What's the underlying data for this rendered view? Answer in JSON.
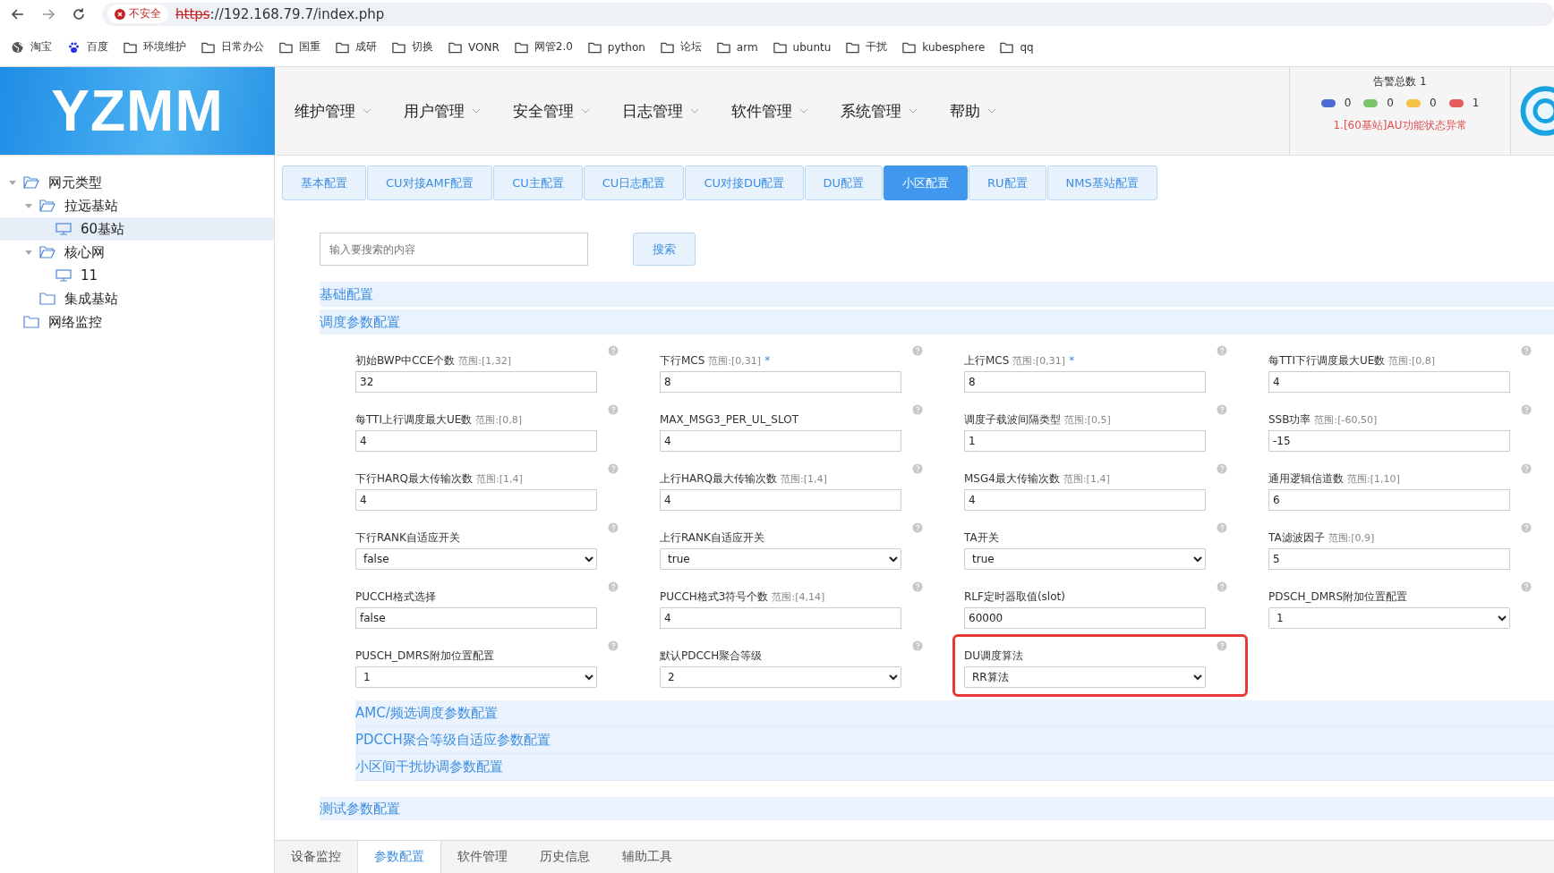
{
  "browser": {
    "security_label": "不安全",
    "url_scheme": "https",
    "url_rest": "://192.168.79.7/index.php"
  },
  "bookmarks": [
    {
      "label": "淘宝",
      "kind": "globe"
    },
    {
      "label": "百度",
      "kind": "paw"
    },
    {
      "label": "环境维护",
      "kind": "folder"
    },
    {
      "label": "日常办公",
      "kind": "folder"
    },
    {
      "label": "国重",
      "kind": "folder"
    },
    {
      "label": "成研",
      "kind": "folder"
    },
    {
      "label": "切换",
      "kind": "folder"
    },
    {
      "label": "VONR",
      "kind": "folder"
    },
    {
      "label": "网管2.0",
      "kind": "folder"
    },
    {
      "label": "python",
      "kind": "folder"
    },
    {
      "label": "论坛",
      "kind": "folder"
    },
    {
      "label": "arm",
      "kind": "folder"
    },
    {
      "label": "ubuntu",
      "kind": "folder"
    },
    {
      "label": "干扰",
      "kind": "folder"
    },
    {
      "label": "kubesphere",
      "kind": "folder"
    },
    {
      "label": "qq",
      "kind": "folder"
    }
  ],
  "header": {
    "logo": "YZMM",
    "menu": [
      "维护管理",
      "用户管理",
      "安全管理",
      "日志管理",
      "软件管理",
      "系统管理",
      "帮助"
    ],
    "alarm": {
      "title": "告警总数 1",
      "counters": [
        {
          "color": "#4a6bd0",
          "count": "0"
        },
        {
          "color": "#7cc46a",
          "count": "0"
        },
        {
          "color": "#f5c343",
          "count": "0"
        },
        {
          "color": "#e55a5a",
          "count": "1"
        }
      ],
      "message": "1.[60基站]AU功能状态异常"
    }
  },
  "tree": [
    {
      "label": "网元类型",
      "kind": "folder",
      "expanded": true,
      "selected": false,
      "children": [
        {
          "label": "拉远基站",
          "kind": "folder",
          "expanded": true,
          "selected": false,
          "children": [
            {
              "label": "60基站",
              "kind": "device",
              "selected": true
            }
          ]
        },
        {
          "label": "核心网",
          "kind": "folder",
          "expanded": true,
          "selected": false,
          "children": [
            {
              "label": "11",
              "kind": "device",
              "selected": false
            }
          ]
        },
        {
          "label": "集成基站",
          "kind": "folder",
          "selected": false
        }
      ]
    },
    {
      "label": "网络监控",
      "kind": "folder",
      "expanded": false,
      "selected": false
    }
  ],
  "config_tabs": [
    {
      "label": "基本配置",
      "selected": false
    },
    {
      "label": "CU对接AMF配置",
      "selected": false
    },
    {
      "label": "CU主配置",
      "selected": false
    },
    {
      "label": "CU日志配置",
      "selected": false
    },
    {
      "label": "CU对接DU配置",
      "selected": false
    },
    {
      "label": "DU配置",
      "selected": false
    },
    {
      "label": "小区配置",
      "selected": true
    },
    {
      "label": "RU配置",
      "selected": false
    },
    {
      "label": "NMS基站配置",
      "selected": false
    }
  ],
  "search": {
    "placeholder": "输入要搜索的内容",
    "button": "搜索"
  },
  "sections": [
    {
      "title": "基础配置"
    },
    {
      "title": "调度参数配置",
      "fields": [
        {
          "label": "初始BWP中CCE个数",
          "range": "范围:[1,32]",
          "kind": "input",
          "value": "32",
          "highlighted": false
        },
        {
          "label": "下行MCS",
          "range": "范围:[0,31]",
          "required_mark": "*",
          "kind": "input",
          "value": "8",
          "highlighted": false
        },
        {
          "label": "上行MCS",
          "range": "范围:[0,31]",
          "required_mark": "*",
          "kind": "input",
          "value": "8",
          "highlighted": false
        },
        {
          "label": "每TTI下行调度最大UE数",
          "range": "范围:[0,8]",
          "kind": "input",
          "value": "4",
          "highlighted": false
        },
        {
          "label": "每TTI上行调度最大UE数",
          "range": "范围:[0,8]",
          "kind": "input",
          "value": "4",
          "highlighted": false
        },
        {
          "label": "MAX_MSG3_PER_UL_SLOT",
          "kind": "input",
          "value": "4",
          "highlighted": false
        },
        {
          "label": "调度子载波间隔类型",
          "range": "范围:[0,5]",
          "kind": "input",
          "value": "1",
          "highlighted": false
        },
        {
          "label": "SSB功率",
          "range": "范围:[-60,50]",
          "kind": "input",
          "value": "-15",
          "highlighted": false
        },
        {
          "label": "下行HARQ最大传输次数",
          "range": "范围:[1,4]",
          "kind": "input",
          "value": "4",
          "highlighted": false
        },
        {
          "label": "上行HARQ最大传输次数",
          "range": "范围:[1,4]",
          "kind": "input",
          "value": "4",
          "highlighted": false
        },
        {
          "label": "MSG4最大传输次数",
          "range": "范围:[1,4]",
          "kind": "input",
          "value": "4",
          "highlighted": false
        },
        {
          "label": "通用逻辑信道数",
          "range": "范围:[1,10]",
          "kind": "input",
          "value": "6",
          "highlighted": false
        },
        {
          "label": "下行RANK自适应开关",
          "kind": "select",
          "value": "false",
          "highlighted": false
        },
        {
          "label": "上行RANK自适应开关",
          "kind": "select",
          "value": "true",
          "highlighted": false
        },
        {
          "label": "TA开关",
          "kind": "select",
          "value": "true",
          "highlighted": false
        },
        {
          "label": "TA滤波因子",
          "range": "范围:[0,9]",
          "kind": "input",
          "value": "5",
          "highlighted": false
        },
        {
          "label": "PUCCH格式选择",
          "kind": "input",
          "value": "false",
          "highlighted": false
        },
        {
          "label": "PUCCH格式3符号个数",
          "range": "范围:[4,14]",
          "kind": "input",
          "value": "4",
          "highlighted": false
        },
        {
          "label": "RLF定时器取值(slot)",
          "kind": "input",
          "value": "60000",
          "highlighted": false
        },
        {
          "label": "PDSCH_DMRS附加位置配置",
          "kind": "select",
          "value": "1",
          "highlighted": false
        },
        {
          "label": "PUSCH_DMRS附加位置配置",
          "kind": "select",
          "value": "1",
          "highlighted": false
        },
        {
          "label": "默认PDCCH聚合等级",
          "kind": "select",
          "value": "2",
          "highlighted": false
        },
        {
          "label": "DU调度算法",
          "kind": "select",
          "value": "RR算法",
          "highlighted": true
        }
      ],
      "subsections": [
        "AMC/频选调度参数配置",
        "PDCCH聚合等级自适应参数配置",
        "小区间干扰协调参数配置"
      ]
    },
    {
      "title": "测试参数配置"
    }
  ],
  "bottom_tabs": [
    {
      "label": "设备监控",
      "selected": false
    },
    {
      "label": "参数配置",
      "selected": true
    },
    {
      "label": "软件管理",
      "selected": false
    },
    {
      "label": "历史信息",
      "selected": false
    },
    {
      "label": "辅助工具",
      "selected": false
    }
  ]
}
